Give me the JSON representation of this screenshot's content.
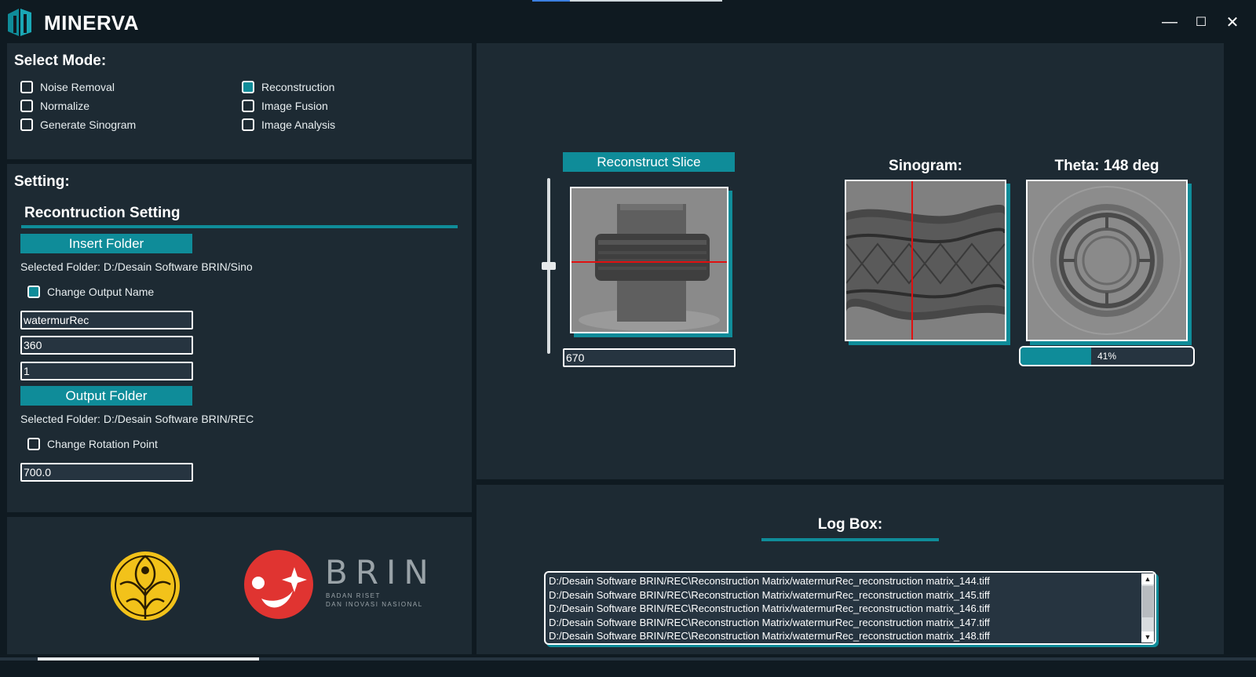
{
  "app": {
    "title": "MINERVA"
  },
  "window": {
    "minimize": "—",
    "maximize": "☐",
    "close": "✕"
  },
  "mode": {
    "heading": "Select Mode:",
    "options": [
      {
        "label": "Noise Removal",
        "checked": false
      },
      {
        "label": "Normalize",
        "checked": false
      },
      {
        "label": "Generate Sinogram",
        "checked": false
      },
      {
        "label": "Reconstruction",
        "checked": true
      },
      {
        "label": "Image Fusion",
        "checked": false
      },
      {
        "label": "Image Analysis",
        "checked": false
      }
    ]
  },
  "setting": {
    "heading": "Setting:",
    "subheading": "Recontruction Setting",
    "insert_folder_label": "Insert Folder",
    "selected_input": "Selected Folder: D:/Desain Software BRIN/Sino",
    "change_output_name": {
      "label": "Change Output Name",
      "checked": true
    },
    "output_name": "watermurRec",
    "field_2": "360",
    "field_3": "1",
    "output_folder_label": "Output Folder",
    "selected_output": "Selected Folder: D:/Desain Software BRIN/REC",
    "change_rotation": {
      "label": "Change Rotation Point",
      "checked": false
    },
    "rotation_point": "700.0"
  },
  "logos": {
    "brin_text": "BRIN",
    "brin_sub1": "BADAN RISET",
    "brin_sub2": "DAN INOVASI NASIONAL"
  },
  "viewer": {
    "reconstruct_label": "Reconstruct Slice",
    "slice_value": "670",
    "slider_fraction": 0.5,
    "sinogram_title": "Sinogram:",
    "theta_title": "Theta: 148 deg",
    "progress": {
      "percent": 41,
      "label": "41%"
    }
  },
  "log": {
    "title": "Log Box:",
    "lines": [
      "D:/Desain Software BRIN/REC\\Reconstruction Matrix/watermurRec_reconstruction matrix_144.tiff",
      "D:/Desain Software BRIN/REC\\Reconstruction Matrix/watermurRec_reconstruction matrix_145.tiff",
      "D:/Desain Software BRIN/REC\\Reconstruction Matrix/watermurRec_reconstruction matrix_146.tiff",
      "D:/Desain Software BRIN/REC\\Reconstruction Matrix/watermurRec_reconstruction matrix_147.tiff",
      "D:/Desain Software BRIN/REC\\Reconstruction Matrix/watermurRec_reconstruction matrix_148.tiff"
    ]
  },
  "colors": {
    "accent": "#0f8c99",
    "panel": "#1d2a33",
    "background": "#0f1a21",
    "brin_red": "#e03431",
    "ui_gold": "#f2c21a"
  }
}
